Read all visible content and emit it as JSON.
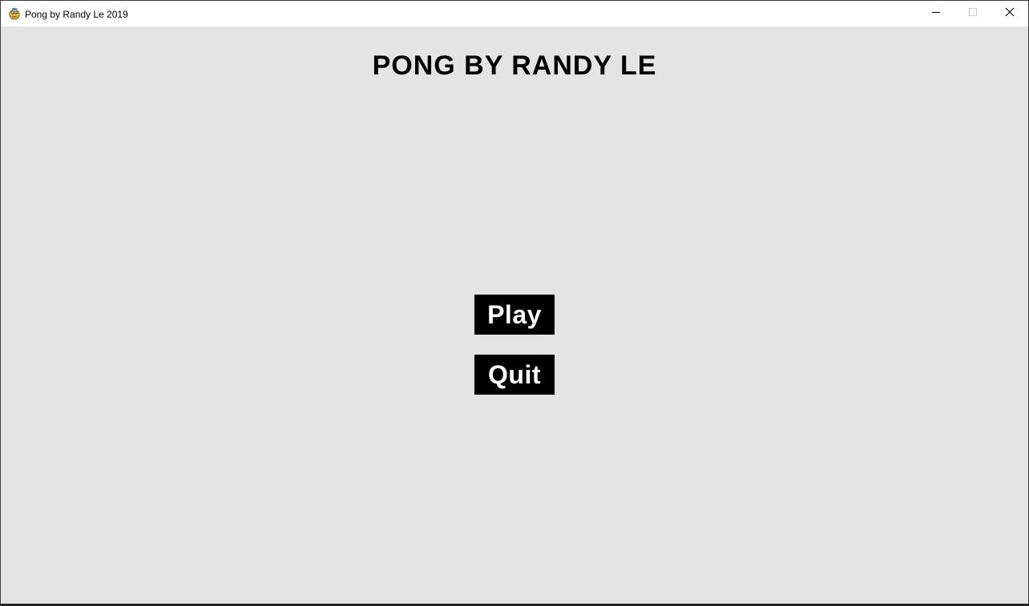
{
  "window": {
    "title": "Pong by Randy Le 2019",
    "icon": "pygame-snake-icon",
    "controls": {
      "minimize_icon": "minimize-icon",
      "maximize_icon": "maximize-icon",
      "close_icon": "close-icon"
    }
  },
  "game": {
    "title": "PONG BY RANDY LE",
    "background_color": "#e4e4e4",
    "menu": {
      "play_label": "Play",
      "quit_label": "Quit",
      "button_color": "#000000",
      "button_text_color": "#ffffff"
    }
  }
}
